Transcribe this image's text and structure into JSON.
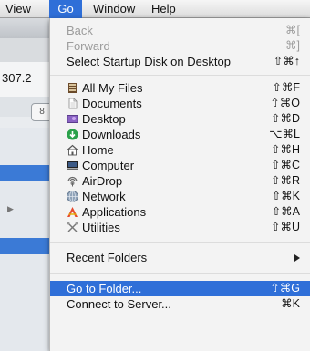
{
  "background": {
    "address_value": "307.2",
    "button_glyph": "8"
  },
  "menubar": {
    "items": [
      {
        "label": "View"
      },
      {
        "label": "Go"
      },
      {
        "label": "Window"
      },
      {
        "label": "Help"
      }
    ]
  },
  "go_menu": {
    "navigation": [
      {
        "label": "Back",
        "shortcut": "⌘[",
        "enabled": false
      },
      {
        "label": "Forward",
        "shortcut": "⌘]",
        "enabled": false
      },
      {
        "label": "Select Startup Disk on Desktop",
        "shortcut": "⇧⌘↑",
        "enabled": true
      }
    ],
    "locations": [
      {
        "label": "All My Files",
        "shortcut": "⇧⌘F",
        "icon": "all-my-files-icon"
      },
      {
        "label": "Documents",
        "shortcut": "⇧⌘O",
        "icon": "documents-icon"
      },
      {
        "label": "Desktop",
        "shortcut": "⇧⌘D",
        "icon": "desktop-icon"
      },
      {
        "label": "Downloads",
        "shortcut": "⌥⌘L",
        "icon": "downloads-icon"
      },
      {
        "label": "Home",
        "shortcut": "⇧⌘H",
        "icon": "home-icon"
      },
      {
        "label": "Computer",
        "shortcut": "⇧⌘C",
        "icon": "computer-icon"
      },
      {
        "label": "AirDrop",
        "shortcut": "⇧⌘R",
        "icon": "airdrop-icon"
      },
      {
        "label": "Network",
        "shortcut": "⇧⌘K",
        "icon": "network-icon"
      },
      {
        "label": "Applications",
        "shortcut": "⇧⌘A",
        "icon": "applications-icon"
      },
      {
        "label": "Utilities",
        "shortcut": "⇧⌘U",
        "icon": "utilities-icon"
      }
    ],
    "recent_folders": {
      "label": "Recent Folders"
    },
    "go_to_folder": {
      "label": "Go to Folder...",
      "shortcut": "⇧⌘G",
      "highlighted": true
    },
    "connect_to_server": {
      "label": "Connect to Server...",
      "shortcut": "⌘K"
    }
  },
  "colors": {
    "highlight": "#2f6fd8",
    "disabled_text": "#9c9c9c",
    "downloads_green": "#2aa14a"
  }
}
